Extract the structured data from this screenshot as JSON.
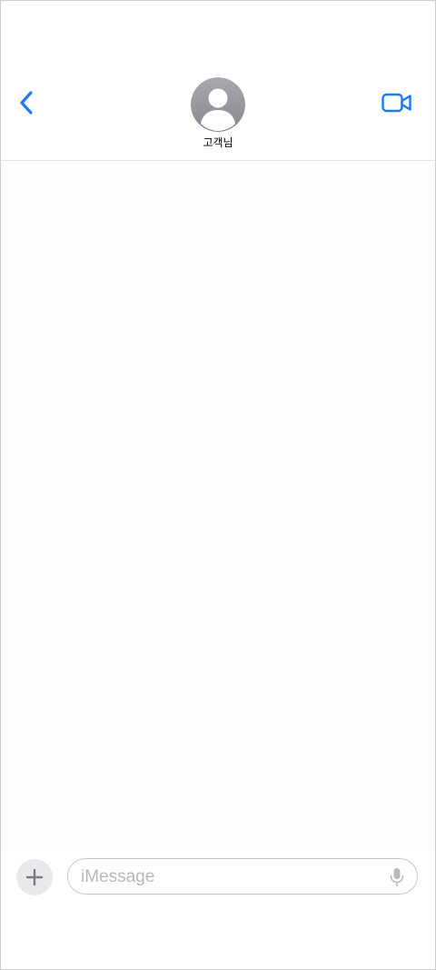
{
  "header": {
    "contact_name": "고객님",
    "back_icon": "chevron-left-icon",
    "video_icon": "video-camera-icon",
    "avatar_icon": "person-silhouette-icon"
  },
  "composer": {
    "placeholder": "iMessage",
    "add_icon": "plus-icon",
    "mic_icon": "microphone-icon"
  },
  "colors": {
    "accent": "#1a7cf2",
    "avatar_gray": "#9b9ca1",
    "composer_border": "#c9c9cc",
    "placeholder": "#b8b8bc"
  }
}
